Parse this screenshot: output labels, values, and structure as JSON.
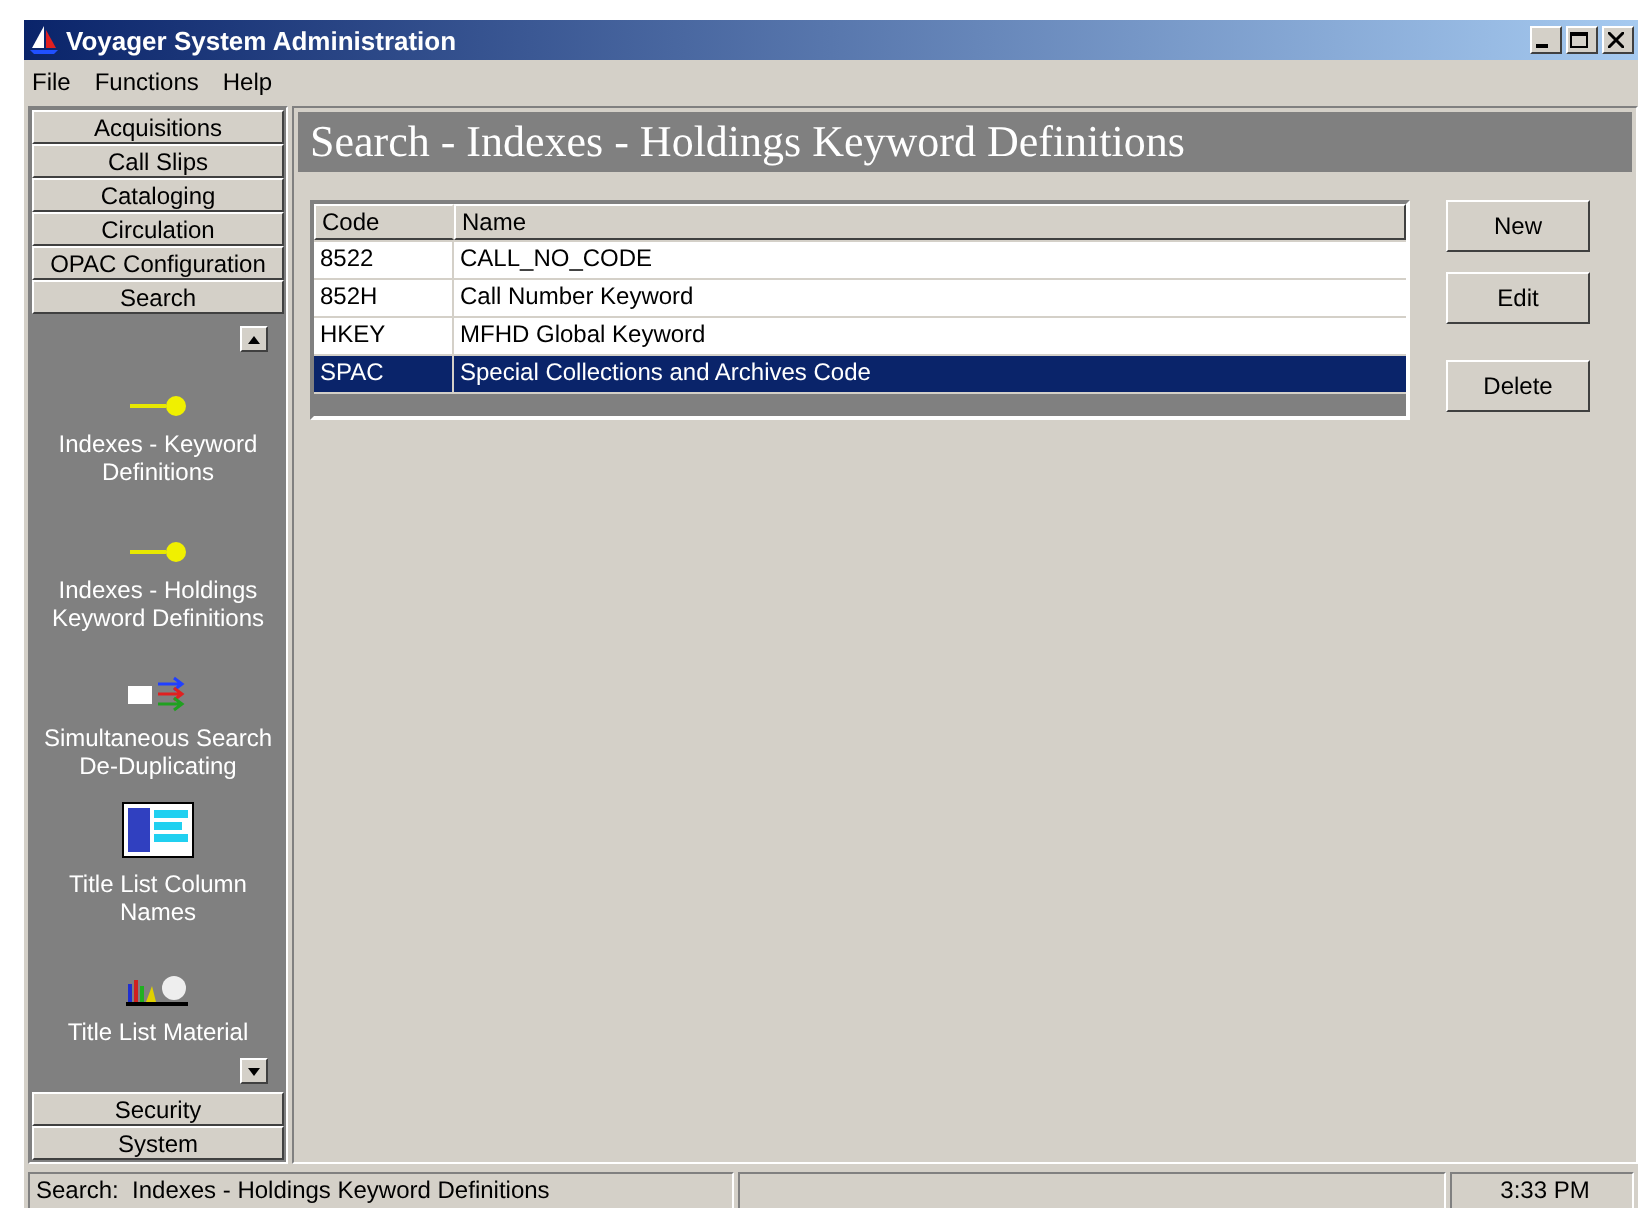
{
  "window": {
    "title": "Voyager System Administration"
  },
  "menu": [
    "File",
    "Functions",
    "Help"
  ],
  "sidebar": {
    "groups": [
      {
        "label": "Acquisitions"
      },
      {
        "label": "Call Slips"
      },
      {
        "label": "Cataloging"
      },
      {
        "label": "Circulation"
      },
      {
        "label": "OPAC Configuration"
      },
      {
        "label": "Search",
        "items": [
          {
            "label": "Indexes - Keyword Definitions",
            "kind": "key"
          },
          {
            "label": "Indexes - Holdings Keyword Definitions",
            "kind": "key"
          },
          {
            "label": "Simultaneous Search De-Duplicating",
            "kind": "dedup"
          },
          {
            "label": "Title List Column Names",
            "kind": "columns"
          },
          {
            "label": "Title List Material",
            "kind": "material"
          }
        ]
      },
      {
        "label": "Security"
      },
      {
        "label": "System"
      }
    ]
  },
  "page_title": "Search - Indexes - Holdings Keyword Definitions",
  "table": {
    "columns": [
      "Code",
      "Name"
    ],
    "rows": [
      {
        "cells": [
          "8522",
          "CALL_NO_CODE"
        ],
        "selected": false
      },
      {
        "cells": [
          "852H",
          "Call Number Keyword"
        ],
        "selected": false
      },
      {
        "cells": [
          "HKEY",
          "MFHD Global Keyword"
        ],
        "selected": false
      },
      {
        "cells": [
          "SPAC",
          "Special Collections and Archives Code"
        ],
        "selected": true
      }
    ]
  },
  "buttons": [
    "New",
    "Edit",
    "Delete"
  ],
  "status_bar": {
    "message": "Search:  Indexes - Holdings Keyword Definitions",
    "time": "3:33 PM"
  }
}
